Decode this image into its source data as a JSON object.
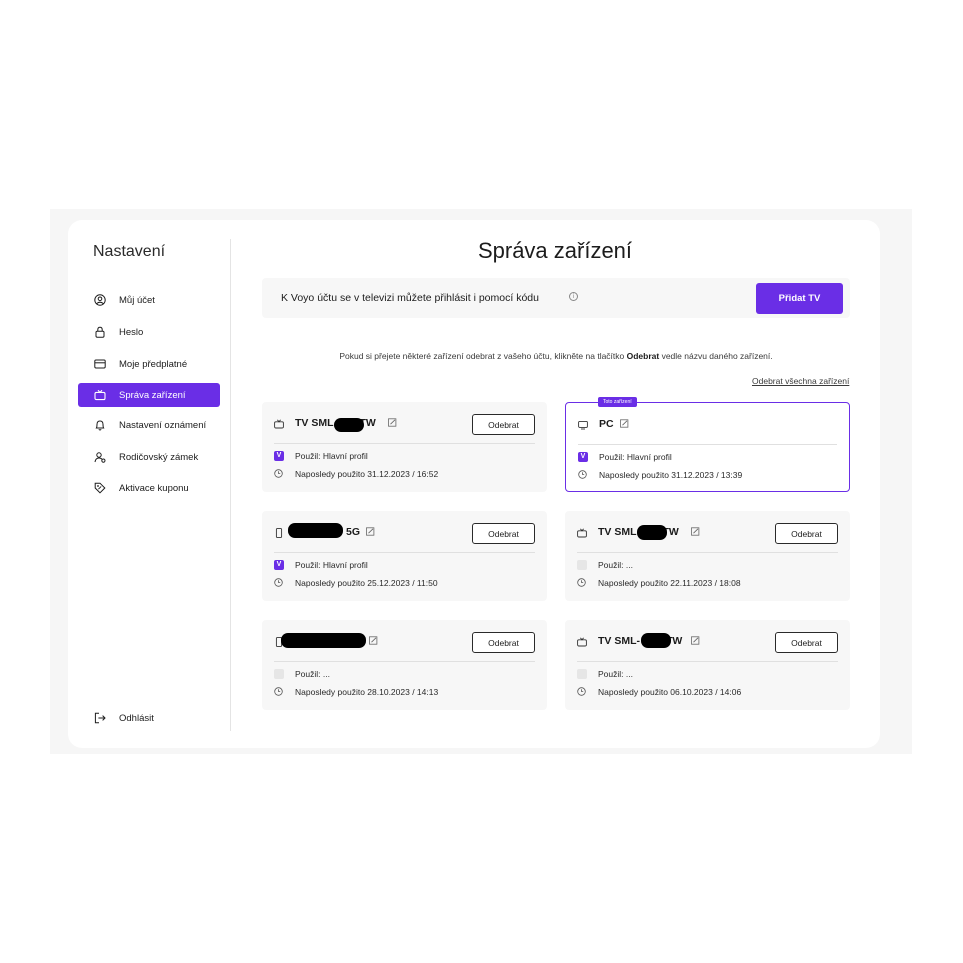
{
  "sidebar": {
    "title": "Nastavení",
    "items": [
      {
        "label": "Můj účet",
        "icon": "user-circle-icon"
      },
      {
        "label": "Heslo",
        "icon": "lock-icon"
      },
      {
        "label": "Moje předplatné",
        "icon": "credit-card-icon"
      },
      {
        "label": "Správa zařízení",
        "icon": "tv-icon",
        "active": true
      },
      {
        "label": "Nastavení oznámení",
        "icon": "bell-icon"
      },
      {
        "label": "Rodičovský zámek",
        "icon": "parental-lock-icon"
      },
      {
        "label": "Aktivace kuponu",
        "icon": "coupon-icon"
      }
    ],
    "logout_label": "Odhlásit"
  },
  "main": {
    "title": "Správa zařízení",
    "info_text": "K Voyo účtu se v televizi můžete přihlásit i pomocí kódu",
    "add_tv_label": "Přidat TV",
    "hint_before": "Pokud si přejete některé zařízení odebrat z vašeho účtu, klikněte na tlačítko ",
    "hint_bold": "Odebrat",
    "hint_after": " vedle názvu daného zařízení.",
    "remove_all_label": "Odebrat všechna zařízení",
    "current_device_badge": "Toto zařízení",
    "remove_label": "Odebrat",
    "devices": [
      {
        "name": "TV SML",
        "name_suffix": "TW",
        "type": "tv-icon",
        "profile": "Použil: Hlavní profil",
        "profile_checked": true,
        "last_used": "Naposledy použito 31.12.2023 / 16:52",
        "current": false
      },
      {
        "name": "PC",
        "name_suffix": "",
        "type": "monitor-icon",
        "profile": "Použil: Hlavní profil",
        "profile_checked": true,
        "last_used": "Naposledy použito 31.12.2023 / 13:39",
        "current": true
      },
      {
        "name": "",
        "name_suffix": "5G",
        "type": "phone-icon",
        "profile": "Použil: Hlavní profil",
        "profile_checked": true,
        "last_used": "Naposledy použito 25.12.2023 / 11:50",
        "current": false
      },
      {
        "name": "TV SML",
        "name_suffix": "TW",
        "type": "tv-icon",
        "profile": "Použil: ...",
        "profile_checked": false,
        "last_used": "Naposledy použito 22.11.2023 / 18:08",
        "current": false
      },
      {
        "name": "",
        "name_suffix": "",
        "type": "phone-icon",
        "profile": "Použil: ...",
        "profile_checked": false,
        "last_used": "Naposledy použito 28.10.2023 / 14:13",
        "current": false
      },
      {
        "name": "TV SML-",
        "name_suffix": "TW",
        "type": "tv-icon",
        "profile": "Použil: ...",
        "profile_checked": false,
        "last_used": "Naposledy použito 06.10.2023 / 14:06",
        "current": false
      }
    ]
  },
  "colors": {
    "accent": "#6a2ee6",
    "card_bg": "#f7f7f7",
    "page_bg": "#f6f6f6"
  }
}
